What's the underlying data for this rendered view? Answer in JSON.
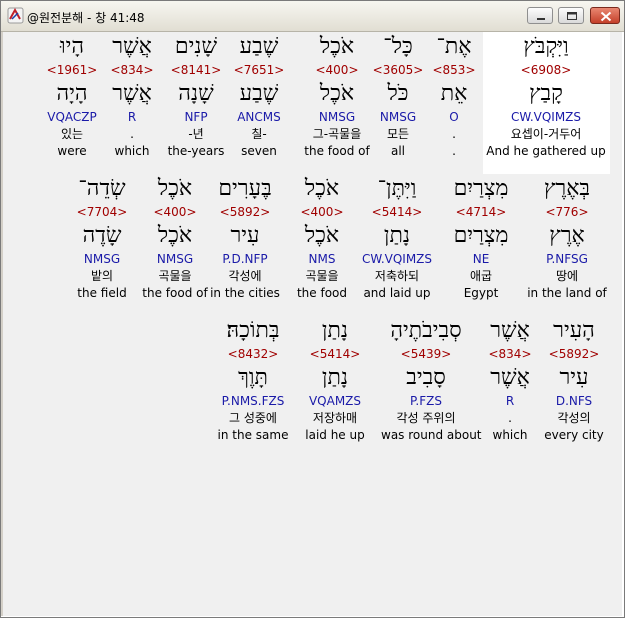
{
  "window": {
    "title": "@원전분해 - 창 41:48",
    "icon": "compass-icon",
    "controls": [
      "minimize-icon",
      "maximize-icon",
      "close-icon"
    ]
  },
  "lines": [
    {
      "words": [
        {
          "heb": "וַיִּקְבֹּץ",
          "strong": "<6908>",
          "lex": "קָבַץ",
          "parse": "CW.VQIMZS",
          "kor": "요셉이-거두어",
          "eng": "And he gathered up",
          "selected": true
        },
        {
          "heb": "אֶת־",
          "strong": "<853>",
          "lex": "אֵת",
          "parse": "O",
          "kor": ".",
          "eng": "."
        },
        {
          "heb": "כָּל־",
          "strong": "<3605>",
          "lex": "כֹּל",
          "parse": "NMSG",
          "kor": "모든",
          "eng": "all"
        },
        {
          "heb": "אֹכֶל",
          "strong": "<400>",
          "lex": "אֹכֶל",
          "parse": "NMSG",
          "kor": "그-곡물을",
          "eng": "the food of"
        },
        {
          "heb": "שֶׁבַע",
          "strong": "<7651>",
          "lex": "שֶׁבַע",
          "parse": "ANCMS",
          "kor": "칠-",
          "eng": "seven"
        },
        {
          "heb": "שָׁנִים",
          "strong": "<8141>",
          "lex": "שָׁנָה",
          "parse": "NFP",
          "kor": "-년",
          "eng": "the-years"
        },
        {
          "heb": "אֲשֶׁר",
          "strong": "<834>",
          "lex": "אֲשֶׁר",
          "parse": "R",
          "kor": ".",
          "eng": "which"
        },
        {
          "heb": "הָיוּ",
          "strong": "<1961>",
          "lex": "הָיָה",
          "parse": "VQACZP",
          "kor": "있는",
          "eng": "were"
        }
      ]
    },
    {
      "words": [
        {
          "heb": "בְּאֶרֶץ",
          "strong": "<776>",
          "lex": "אֶרֶץ",
          "parse": "P.NFSG",
          "kor": "땅에",
          "eng": "in the land of"
        },
        {
          "heb": "מִצְרַיִם",
          "strong": "<4714>",
          "lex": "מִצְרַיִם",
          "parse": "NE",
          "kor": "애굽",
          "eng": "Egypt"
        },
        {
          "heb": "וַיִּתֶּן־",
          "strong": "<5414>",
          "lex": "נָתַן",
          "parse": "CW.VQIMZS",
          "kor": "저축하되",
          "eng": "and laid up"
        },
        {
          "heb": "אֹכֶל",
          "strong": "<400>",
          "lex": "אֹכֶל",
          "parse": "NMS",
          "kor": "곡물을",
          "eng": "the food"
        },
        {
          "heb": "בֶּעָרִים",
          "strong": "<5892>",
          "lex": "עִיר",
          "parse": "P.D.NFP",
          "kor": "각성에",
          "eng": "in the cities"
        },
        {
          "heb": "אֹכֶל",
          "strong": "<400>",
          "lex": "אֹכֶל",
          "parse": "NMSG",
          "kor": "곡물을",
          "eng": "the food of"
        },
        {
          "heb": "שְׂדֵה־",
          "strong": "<7704>",
          "lex": "שָׂדֶה",
          "parse": "NMSG",
          "kor": "밭의",
          "eng": "the field"
        }
      ]
    },
    {
      "words": [
        {
          "heb": "הָעִיר",
          "strong": "<5892>",
          "lex": "עִיר",
          "parse": "D.NFS",
          "kor": "각성의",
          "eng": "every city"
        },
        {
          "heb": "אֲשֶׁר",
          "strong": "<834>",
          "lex": "אֲשֶׁר",
          "parse": "R",
          "kor": ".",
          "eng": "which"
        },
        {
          "heb": "סְבִיבֹתֶיהָ",
          "strong": "<5439>",
          "lex": "סָבִיב",
          "parse": "P.FZS",
          "kor": "각성 주위의",
          "eng": "was round about"
        },
        {
          "heb": "נָתַן",
          "strong": "<5414>",
          "lex": "נָתַן",
          "parse": "VQAMZS",
          "kor": "저장하매",
          "eng": "laid he up"
        },
        {
          "heb": "בְּתוֹכָהּ׃",
          "strong": "<8432>",
          "lex": "תָּוֶךְ",
          "parse": "P.NMS.FZS",
          "kor": "그 성중에",
          "eng": "in the same"
        }
      ]
    }
  ],
  "colors": {
    "strong": "#a00000",
    "parse": "#1a1aa8",
    "selected_bg": "#ffffff",
    "content_bg": "#f0f0f0"
  }
}
